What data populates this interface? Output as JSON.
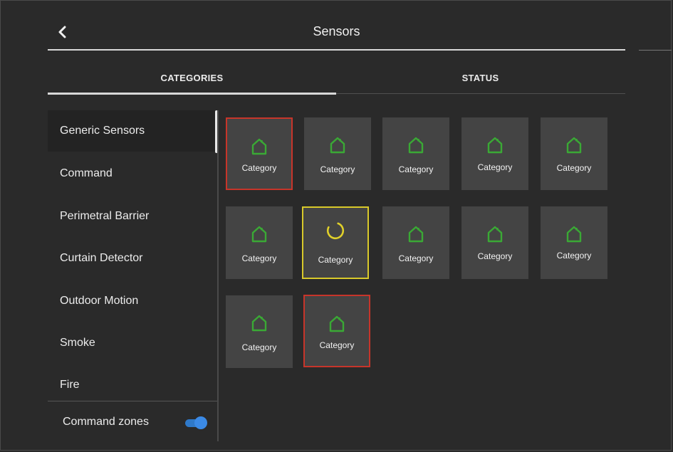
{
  "header": {
    "title": "Sensors",
    "back_icon": "chevron-left-icon"
  },
  "tabs": [
    {
      "label": "CATEGORIES",
      "active": true
    },
    {
      "label": "STATUS",
      "active": false
    }
  ],
  "sidebar": {
    "items": [
      {
        "label": "Generic Sensors",
        "active": true
      },
      {
        "label": "Command",
        "active": false
      },
      {
        "label": "Perimetral Barrier",
        "active": false
      },
      {
        "label": "Curtain Detector",
        "active": false
      },
      {
        "label": "Outdoor Motion",
        "active": false
      },
      {
        "label": "Smoke",
        "active": false
      },
      {
        "label": "Fire",
        "active": false
      }
    ],
    "command_zones": {
      "label": "Command zones",
      "enabled": true
    }
  },
  "grid": {
    "tiles": [
      {
        "label": "Category",
        "icon": "house-icon",
        "state": "error"
      },
      {
        "label": "Category",
        "icon": "house-icon",
        "state": "normal"
      },
      {
        "label": "Category",
        "icon": "house-icon",
        "state": "normal"
      },
      {
        "label": "Category",
        "icon": "house-icon",
        "state": "normal"
      },
      {
        "label": "Category",
        "icon": "house-icon",
        "state": "normal"
      },
      {
        "label": "Category",
        "icon": "house-icon",
        "state": "normal"
      },
      {
        "label": "Category",
        "icon": "spinner-icon",
        "state": "loading"
      },
      {
        "label": "Category",
        "icon": "house-icon",
        "state": "normal"
      },
      {
        "label": "Category",
        "icon": "house-icon",
        "state": "normal"
      },
      {
        "label": "Category",
        "icon": "house-icon",
        "state": "normal"
      },
      {
        "label": "Category",
        "icon": "house-icon",
        "state": "normal"
      },
      {
        "label": "Category",
        "icon": "house-icon",
        "state": "error"
      }
    ]
  },
  "colors": {
    "background": "#2a2a2a",
    "tile": "#444444",
    "icon_green": "#3aa935",
    "error_border": "#c7352a",
    "loading_border": "#d9c92a",
    "toggle": "#3b8ae6"
  }
}
